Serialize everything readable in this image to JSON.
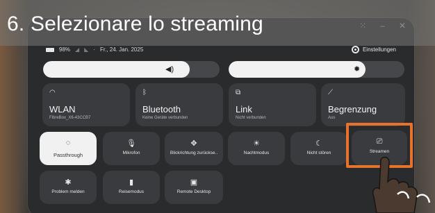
{
  "banner": {
    "title": "6. Selezionare lo streaming"
  },
  "status": {
    "battery": "98%",
    "separator": "·",
    "date": "Fr., 24. Jan. 2025"
  },
  "header": {
    "settings_label": "Einstellungen"
  },
  "sliders": {
    "volume": {
      "icon": "speaker-icon",
      "level": 0.83
    },
    "brightness": {
      "icon": "sun-icon",
      "level": 0.78
    }
  },
  "big_tiles": [
    {
      "label": "WLAN",
      "sub": "FibreBox_X6-43CCB7",
      "icon": "wifi-icon"
    },
    {
      "label": "Bluetooth",
      "sub": "Keine Geräte verbunden",
      "icon": "bluetooth-icon"
    },
    {
      "label": "Link",
      "sub": "Nicht verbunden",
      "icon": "link-icon"
    },
    {
      "label": "Begrenzung",
      "sub": "Aus",
      "icon": "boundary-icon"
    }
  ],
  "small_tiles": [
    {
      "label": "Passthrough",
      "icon": "passthrough-icon",
      "active": true
    },
    {
      "label": "Mikrofon",
      "icon": "microphone-icon"
    },
    {
      "label": "Blickrichtung zurückse..",
      "icon": "recenter-icon"
    },
    {
      "label": "Nachtmodus",
      "icon": "night-mode-icon"
    },
    {
      "label": "Nicht stören",
      "icon": "moon-icon"
    },
    {
      "label": "Streamen",
      "icon": "cast-icon"
    },
    {
      "label": "Problem melden",
      "icon": "bug-icon"
    },
    {
      "label": "Reisemodus",
      "icon": "travel-icon"
    },
    {
      "label": "Remote Desktop",
      "icon": "remote-desktop-icon"
    }
  ],
  "highlight_color": "#e8712b"
}
